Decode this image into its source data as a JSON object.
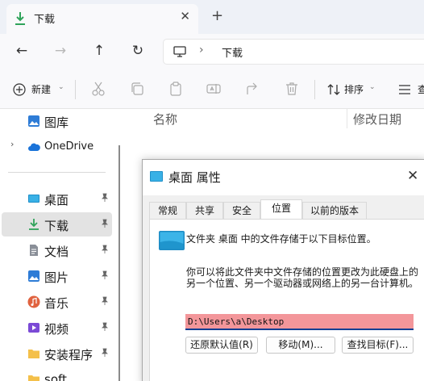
{
  "tab": {
    "title": "下载",
    "close_icon": "close-icon",
    "add_icon": "add-tab-icon"
  },
  "nav": {
    "crumb": "下载"
  },
  "toolbar": {
    "new_label": "新建",
    "sort_label": "排序",
    "view_label": "查"
  },
  "sidebar": {
    "items": [
      {
        "label": "图库"
      },
      {
        "label": "OneDrive"
      },
      {
        "label": "桌面"
      },
      {
        "label": "下载"
      },
      {
        "label": "文档"
      },
      {
        "label": "图片"
      },
      {
        "label": "音乐"
      },
      {
        "label": "视频"
      },
      {
        "label": "安装程序"
      },
      {
        "label": "soft"
      }
    ]
  },
  "content": {
    "col_name": "名称",
    "col_date": "修改日期"
  },
  "dialog": {
    "title": "桌面 属性",
    "tabs": [
      "常规",
      "共享",
      "安全",
      "位置",
      "以前的版本"
    ],
    "active_tab": "位置",
    "desc": "文件夹 桌面 中的文件存储于以下目标位置。",
    "info": "你可以将此文件夹中文件存储的位置更改为此硬盘上的另一个位置、另一个驱动器或网络上的另一台计算机。",
    "path": "D:\\Users\\a\\Desktop",
    "buttons": {
      "restore": "还原默认值(R)",
      "move": "移动(M)...",
      "find": "查找目标(F)..."
    }
  },
  "colors": {
    "accent": "#0f3f93",
    "path_highlight": "#f3969a",
    "download_green": "#2fa35a"
  }
}
